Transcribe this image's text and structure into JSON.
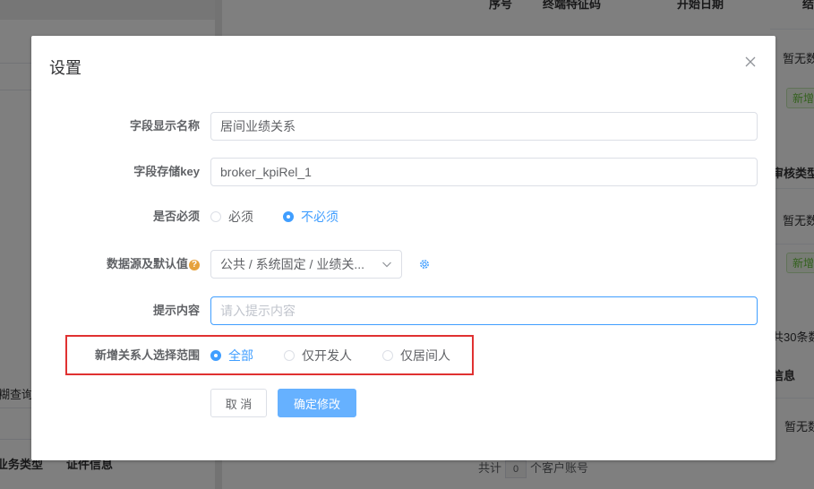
{
  "background": {
    "left_fragments": {
      "search_fuzzy": "糊查询",
      "business_type": "业务类型",
      "credential_info": "证件信息"
    },
    "table_headers": {
      "seq": "序号",
      "terminal_feature": "终端特征码",
      "start_date": "开始日期",
      "end": "结"
    },
    "right_fragments": {
      "no_data_1": "暂无数",
      "tag_new_1": "新增",
      "audit_type": "审核类型",
      "no_data_2": "暂无数",
      "tag_new_2": "新增",
      "total_30": "共30条数",
      "info": "信息",
      "no_data_3": "暂无数"
    },
    "footer": {
      "prefix": "共计",
      "count": "0",
      "suffix": "个客户账号"
    }
  },
  "dialog": {
    "title": "设置",
    "close_icon": "close-icon",
    "fields": {
      "display_name": {
        "label": "字段显示名称",
        "value": "居间业绩关系"
      },
      "storage_key": {
        "label": "字段存储key",
        "value": "broker_kpiRel_1"
      },
      "required": {
        "label": "是否必须",
        "options": [
          "必须",
          "不必须"
        ],
        "selected": "不必须"
      },
      "datasource": {
        "label": "数据源及默认值",
        "value": "公共 / 系统固定 / 业绩关...",
        "icon": "settings-icon"
      },
      "hint": {
        "label": "提示内容",
        "placeholder": "请入提示内容",
        "value": ""
      },
      "relation_scope": {
        "label": "新增关系人选择范围",
        "options": [
          "全部",
          "仅开发人",
          "仅居间人"
        ],
        "selected": "全部"
      }
    },
    "buttons": {
      "cancel": "取 消",
      "confirm": "确定修改"
    }
  },
  "colors": {
    "primary": "#409eff",
    "confirm_button": "#66b1ff",
    "highlight_border": "#e03131",
    "overlay": "rgba(0,0,0,0.5)"
  }
}
